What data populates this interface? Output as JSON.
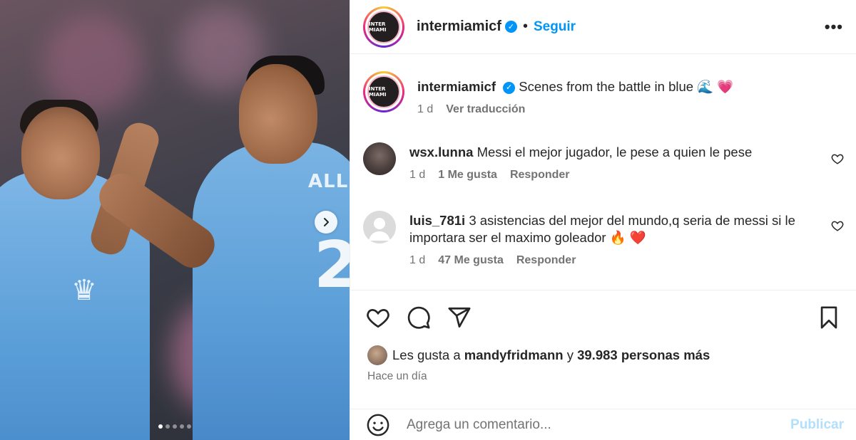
{
  "post": {
    "account": "intermiamicf",
    "follow_label": "Seguir",
    "separator": "•",
    "logo_text": "INTER MIAMI",
    "more_label": "•••"
  },
  "photo": {
    "jersey_name": "ALLE",
    "jersey_number": "2",
    "carousel_dots": 5,
    "active_dot": 0
  },
  "caption": {
    "username": "intermiamicf",
    "text": "Scenes from the battle in blue 🌊 💗",
    "age": "1 d",
    "translate_label": "Ver traducción"
  },
  "comments": [
    {
      "username": "wsx.lunna",
      "text": "Messi el mejor jugador, le pese a quien le pese",
      "age": "1 d",
      "likes": "1 Me gusta",
      "reply_label": "Responder"
    },
    {
      "username": "luis_781i",
      "text": "3 asistencias del mejor del mundo,q seria de messi si le importara ser el maximo goleador 🔥 ❤️",
      "age": "1 d",
      "likes": "47 Me gusta",
      "reply_label": "Responder"
    }
  ],
  "likes": {
    "prefix": "Les gusta a",
    "user": "mandyfridmann",
    "connector": "y",
    "others": "39.983 personas más"
  },
  "timestamp": "Hace un día",
  "composer": {
    "placeholder": "Agrega un comentario...",
    "publish_label": "Publicar"
  },
  "colors": {
    "accent": "#0095f6",
    "publish_disabled": "#b2dffc",
    "muted": "#737373"
  }
}
